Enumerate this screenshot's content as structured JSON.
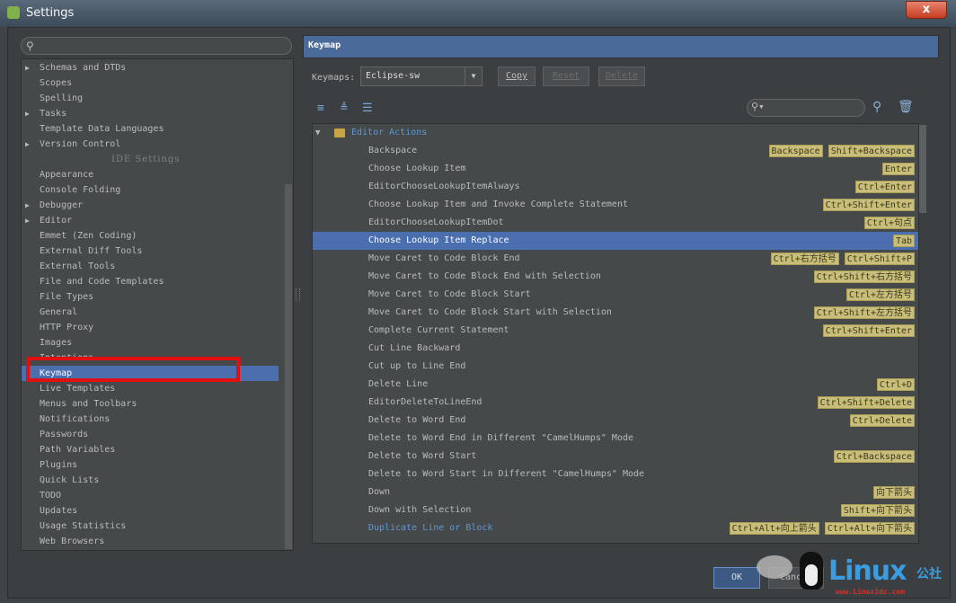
{
  "window": {
    "title": "Settings",
    "close_glyph": "x"
  },
  "left": {
    "search_placeholder": "",
    "items": [
      {
        "label": "Schemas and DTDs",
        "arrow": "▶",
        "type": "folder"
      },
      {
        "label": "Scopes",
        "arrow": "",
        "type": "item"
      },
      {
        "label": "Spelling",
        "arrow": "",
        "type": "item"
      },
      {
        "label": "Tasks",
        "arrow": "▶",
        "type": "folder"
      },
      {
        "label": "Template Data Languages",
        "arrow": "",
        "type": "item"
      },
      {
        "label": "Version Control",
        "arrow": "▶",
        "type": "folder"
      },
      {
        "label": "IDE Settings",
        "arrow": "",
        "type": "separator"
      },
      {
        "label": "Appearance",
        "arrow": "",
        "type": "item"
      },
      {
        "label": "Console Folding",
        "arrow": "",
        "type": "item"
      },
      {
        "label": "Debugger",
        "arrow": "▶",
        "type": "folder"
      },
      {
        "label": "Editor",
        "arrow": "▶",
        "type": "folder"
      },
      {
        "label": "Emmet (Zen Coding)",
        "arrow": "",
        "type": "item"
      },
      {
        "label": "External Diff Tools",
        "arrow": "",
        "type": "item"
      },
      {
        "label": "External Tools",
        "arrow": "",
        "type": "item"
      },
      {
        "label": "File and Code Templates",
        "arrow": "",
        "type": "item"
      },
      {
        "label": "File Types",
        "arrow": "",
        "type": "item"
      },
      {
        "label": "General",
        "arrow": "",
        "type": "item"
      },
      {
        "label": "HTTP Proxy",
        "arrow": "",
        "type": "item"
      },
      {
        "label": "Images",
        "arrow": "",
        "type": "item"
      },
      {
        "label": "Intentions",
        "arrow": "",
        "type": "item"
      },
      {
        "label": "Keymap",
        "arrow": "",
        "type": "selected"
      },
      {
        "label": "Live Templates",
        "arrow": "",
        "type": "item"
      },
      {
        "label": "Menus and Toolbars",
        "arrow": "",
        "type": "item"
      },
      {
        "label": "Notifications",
        "arrow": "",
        "type": "item"
      },
      {
        "label": "Passwords",
        "arrow": "",
        "type": "item"
      },
      {
        "label": "Path Variables",
        "arrow": "",
        "type": "item"
      },
      {
        "label": "Plugins",
        "arrow": "",
        "type": "item"
      },
      {
        "label": "Quick Lists",
        "arrow": "",
        "type": "item"
      },
      {
        "label": "TODO",
        "arrow": "",
        "type": "item"
      },
      {
        "label": "Updates",
        "arrow": "",
        "type": "item"
      },
      {
        "label": "Usage Statistics",
        "arrow": "",
        "type": "item"
      },
      {
        "label": "Web Browsers",
        "arrow": "",
        "type": "item"
      }
    ]
  },
  "right": {
    "header": "Keymap",
    "keymaps_label": "Keymaps:",
    "keymap_value": "Eclipse-sw",
    "buttons": {
      "copy": "Copy",
      "reset": "Reset",
      "delete": "Delete"
    },
    "group": "Editor Actions",
    "actions": [
      {
        "name": "Backspace",
        "keys": [
          "Backspace",
          "Shift+Backspace"
        ],
        "state": ""
      },
      {
        "name": "Choose Lookup Item",
        "keys": [
          "Enter"
        ],
        "state": ""
      },
      {
        "name": "EditorChooseLookupItemAlways",
        "keys": [
          "Ctrl+Enter"
        ],
        "state": ""
      },
      {
        "name": "Choose Lookup Item and Invoke Complete Statement",
        "keys": [
          "Ctrl+Shift+Enter"
        ],
        "state": ""
      },
      {
        "name": "EditorChooseLookupItemDot",
        "keys": [
          "Ctrl+句点"
        ],
        "state": ""
      },
      {
        "name": "Choose Lookup Item Replace",
        "keys": [
          "Tab"
        ],
        "state": "selected"
      },
      {
        "name": "Move Caret to Code Block End",
        "keys": [
          "Ctrl+右方括号",
          "Ctrl+Shift+P"
        ],
        "state": ""
      },
      {
        "name": "Move Caret to Code Block End with Selection",
        "keys": [
          "Ctrl+Shift+右方括号"
        ],
        "state": ""
      },
      {
        "name": "Move Caret to Code Block Start",
        "keys": [
          "Ctrl+左方括号"
        ],
        "state": ""
      },
      {
        "name": "Move Caret to Code Block Start with Selection",
        "keys": [
          "Ctrl+Shift+左方括号"
        ],
        "state": ""
      },
      {
        "name": "Complete Current Statement",
        "keys": [
          "Ctrl+Shift+Enter"
        ],
        "state": ""
      },
      {
        "name": "Cut Line Backward",
        "keys": [],
        "state": ""
      },
      {
        "name": "Cut up to Line End",
        "keys": [],
        "state": ""
      },
      {
        "name": "Delete Line",
        "keys": [
          "Ctrl+D"
        ],
        "state": ""
      },
      {
        "name": "EditorDeleteToLineEnd",
        "keys": [
          "Ctrl+Shift+Delete"
        ],
        "state": ""
      },
      {
        "name": "Delete to Word End",
        "keys": [
          "Ctrl+Delete"
        ],
        "state": ""
      },
      {
        "name": "Delete to Word End in Different \"CamelHumps\" Mode",
        "keys": [],
        "state": ""
      },
      {
        "name": "Delete to Word Start",
        "keys": [
          "Ctrl+Backspace"
        ],
        "state": ""
      },
      {
        "name": "Delete to Word Start in Different \"CamelHumps\" Mode",
        "keys": [],
        "state": ""
      },
      {
        "name": "Down",
        "keys": [
          "向下箭头"
        ],
        "state": ""
      },
      {
        "name": "Down with Selection",
        "keys": [
          "Shift+向下箭头"
        ],
        "state": ""
      },
      {
        "name": "Duplicate Line or Block",
        "keys": [
          "Ctrl+Alt+向上箭头",
          "Ctrl+Alt+向下箭头"
        ],
        "state": "blue"
      }
    ]
  },
  "footer": {
    "ok": "OK",
    "cancel": "Cancel"
  },
  "watermark": {
    "brand": "Linux",
    "cn": "公社",
    "url": "www.Linuxidc.com"
  }
}
